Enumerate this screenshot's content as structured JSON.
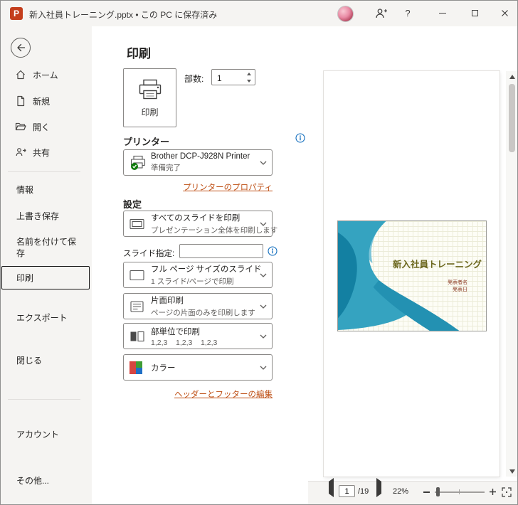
{
  "titlebar": {
    "logo_letter": "P",
    "title": "新入社員トレーニング.pptx • この PC に保存済み",
    "help_label": "?"
  },
  "sidebar": {
    "nav": [
      {
        "label": "ホーム"
      },
      {
        "label": "新規"
      },
      {
        "label": "開く"
      },
      {
        "label": "共有"
      }
    ],
    "menu": [
      {
        "label": "情報"
      },
      {
        "label": "上書き保存"
      },
      {
        "label": "名前を付けて保存"
      },
      {
        "label": "印刷"
      },
      {
        "label": "エクスポート"
      },
      {
        "label": "閉じる"
      }
    ],
    "footer": [
      {
        "label": "アカウント"
      },
      {
        "label": "その他..."
      }
    ]
  },
  "print": {
    "title": "印刷",
    "print_button_label": "印刷",
    "copies_label": "部数:",
    "copies_value": "1",
    "printer_heading": "プリンター",
    "printer_name": "Brother DCP-J928N Printer",
    "printer_status": "準備完了",
    "printer_properties_link": "プリンターのプロパティ",
    "settings_heading": "設定",
    "slides_option_title": "すべてのスライドを印刷",
    "slides_option_subtitle": "プレゼンテーション全体を印刷します",
    "slide_range_label": "スライド指定:",
    "slide_range_value": "",
    "layout_option_title": "フル ページ サイズのスライド",
    "layout_option_subtitle": "1 スライド/ページで印刷",
    "sides_option_title": "片面印刷",
    "sides_option_subtitle": "ページの片面のみを印刷します",
    "collate_option_title": "部単位で印刷",
    "collate_option_subtitle": "1,2,3    1,2,3    1,2,3",
    "color_option_title": "カラー",
    "header_footer_link": "ヘッダーとフッターの編集"
  },
  "preview": {
    "slide_title": "新入社員トレーニング",
    "slide_presenter": "発表者名",
    "slide_date": "発表日",
    "current_page": "1",
    "page_total": "/19",
    "zoom_level": "22%"
  },
  "colors": {
    "accent": "#c43e1c",
    "link": "#bf5117",
    "status_ok": "#0e7a0b",
    "info": "#0f6cbd",
    "slide_teal": "#2a9cbc"
  }
}
